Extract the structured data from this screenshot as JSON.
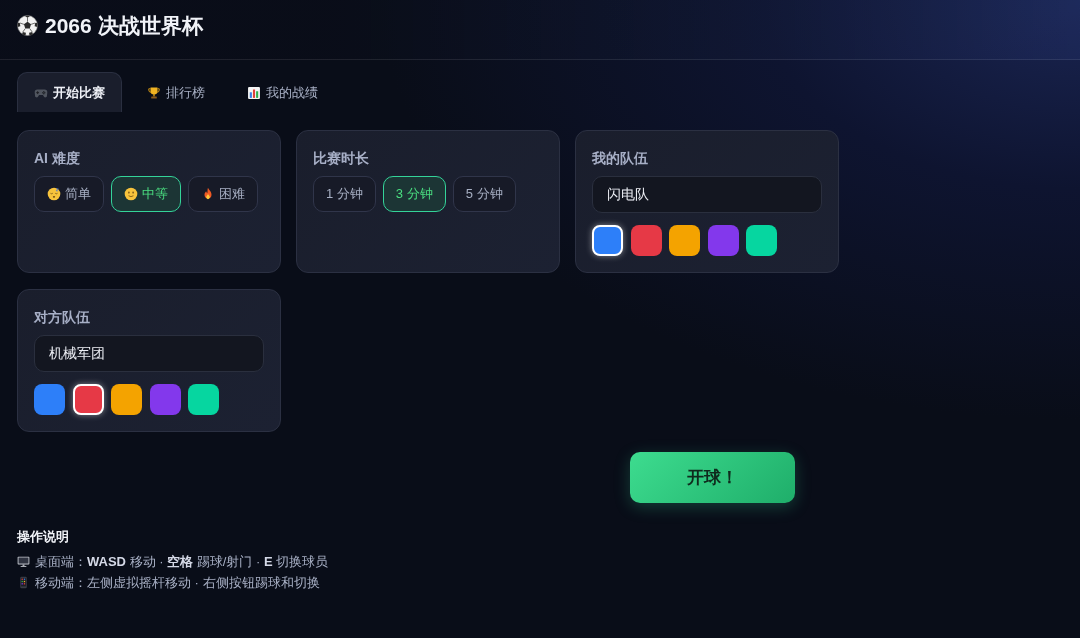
{
  "header": {
    "title": "2066 决战世界杯"
  },
  "tabs": [
    {
      "label": "开始比赛",
      "selected": true
    },
    {
      "label": "排行榜",
      "selected": false
    },
    {
      "label": "我的战绩",
      "selected": false
    }
  ],
  "difficulty": {
    "title": "AI 难度",
    "options": [
      {
        "label": "简单",
        "selected": false
      },
      {
        "label": "中等",
        "selected": true
      },
      {
        "label": "困难",
        "selected": false
      }
    ]
  },
  "duration": {
    "title": "比赛时长",
    "options": [
      {
        "label": "1 分钟",
        "selected": false
      },
      {
        "label": "3 分钟",
        "selected": true
      },
      {
        "label": "5 分钟",
        "selected": false
      }
    ]
  },
  "my_team": {
    "title": "我的队伍",
    "name": "闪电队",
    "colors": [
      {
        "color": "#2d7ff9",
        "selected": true
      },
      {
        "color": "#e63946",
        "selected": false
      },
      {
        "color": "#f4a300",
        "selected": false
      },
      {
        "color": "#8338ec",
        "selected": false
      },
      {
        "color": "#06d6a0",
        "selected": false
      }
    ]
  },
  "opponent_team": {
    "title": "对方队伍",
    "name": "机械军团",
    "colors": [
      {
        "color": "#2d7ff9",
        "selected": false
      },
      {
        "color": "#e63946",
        "selected": true
      },
      {
        "color": "#f4a300",
        "selected": false
      },
      {
        "color": "#8338ec",
        "selected": false
      },
      {
        "color": "#06d6a0",
        "selected": false
      }
    ]
  },
  "start_button": {
    "label": "开球！"
  },
  "instructions": {
    "title": "操作说明",
    "lines": [
      "桌面端：**WASD** 移动 · **空格** 踢球/射门 · **E** 切换球员",
      "移动端：左侧虚拟摇杆移动 · 右侧按钮踢球和切换"
    ]
  }
}
